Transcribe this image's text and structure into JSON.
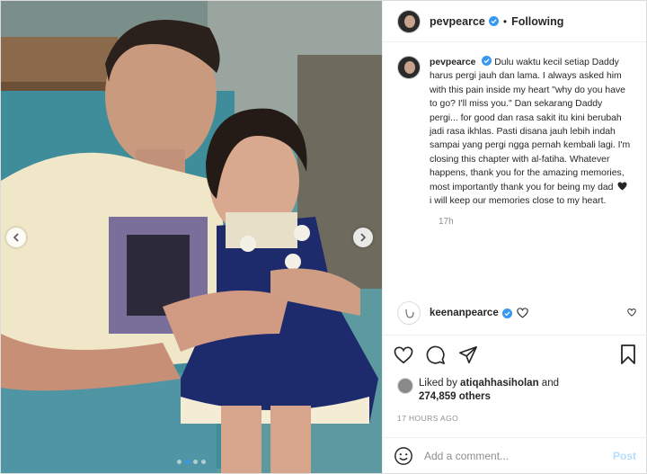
{
  "header": {
    "username": "pevpearce",
    "separator": "•",
    "follow_status": "Following"
  },
  "caption": {
    "username": "pevpearce",
    "text": "Dulu waktu kecil setiap Daddy harus pergi jauh dan lama. I always asked him with this pain inside my heart \"why do you have to go? I'll miss you.\" Dan sekarang Daddy pergi... for good dan rasa sakit itu kini berubah jadi rasa ikhlas. Pasti disana jauh lebih indah sampai yang pergi ngga pernah kembali lagi. I'm closing this chapter with al-fatiha. Whatever happens, thank you for the amazing memories, most importantly thank you for being my dad",
    "text_after_heart": "i will keep our memories close to my heart.",
    "time": "17h"
  },
  "comment": {
    "username": "keenanpearce"
  },
  "likes": {
    "prefix": "Liked by",
    "user": "atiqahhasiholan",
    "joiner": "and",
    "count": "274,859 others"
  },
  "posted_ago": "17 HOURS AGO",
  "add_comment": {
    "placeholder": "Add a comment...",
    "post_label": "Post"
  },
  "carousel": {
    "total": 4,
    "active_index": 1
  },
  "colors": {
    "verified": "#3897f0",
    "post_disabled": "#b2dffc",
    "muted": "#8e8e8e"
  },
  "icons": [
    "chevron-left-icon",
    "chevron-right-icon",
    "verified-icon",
    "heart-icon",
    "comment-icon",
    "share-icon",
    "bookmark-icon",
    "emoji-icon"
  ]
}
